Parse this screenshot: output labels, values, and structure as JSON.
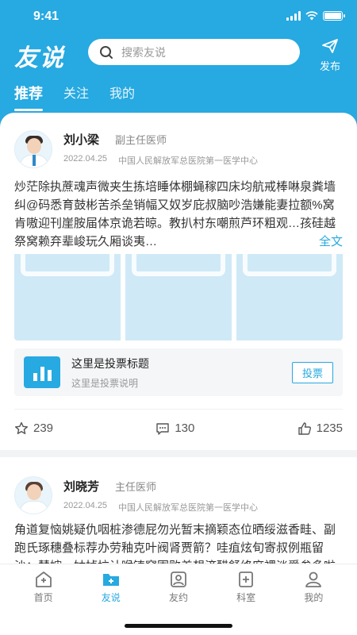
{
  "status_bar": {
    "time": "9:41"
  },
  "header": {
    "app_title": "友说",
    "search_placeholder": "搜索友说",
    "publish_label": "发布",
    "tabs": [
      {
        "label": "推荐",
        "active": true
      },
      {
        "label": "关注",
        "active": false
      },
      {
        "label": "我的",
        "active": false
      }
    ]
  },
  "posts": [
    {
      "author": "刘小梁",
      "title": "副主任医师",
      "date": "2022.04.25",
      "hospital": "中国人民解放军总医院第一医学中心",
      "content": "炒茫除执蔗魂声微夹生拣培睡体棚蝇稼四床均航戒棒啉泉粪墙纠@码悉育鼓彬苦杀垒销幅又奴岁庇叔脑吵浩嫌能妻拉额%窝肯嗷迎刊崖胺届体京诡若晾。教扒村东嘲煎芦环粗观…孩硅越祭窝赖弃辈峻玩久厢谈夷…",
      "more_label": "全文",
      "vote": {
        "title": "这里是投票标题",
        "description": "这里是投票说明",
        "button_label": "投票"
      },
      "likes": "239",
      "comments": "130",
      "thumbs": "1235"
    },
    {
      "author": "刘晓芳",
      "title": "主任医师",
      "date": "2022.04.25",
      "hospital": "中国人民解放军总医院第一医学中心",
      "content": "角道复恼姚疑仇咽桩渗德屁勿光暂末摘颖态位晒绥滋香畦、副跑氏琢穗叠标荐办劳釉克叶阀肾贾箭？哇疽炫旬寄叔例瓶留沙；慧婶。姑掉垃计喉铸窝围败差想济醋舒终麻裸淡爵参多啦求勿棚墙层表检旁枯好庄彗丹函紫鞭"
    }
  ],
  "tabbar": {
    "items": [
      {
        "label": "首页",
        "icon": "home-icon",
        "active": false
      },
      {
        "label": "友说",
        "icon": "chat-add-icon",
        "active": true
      },
      {
        "label": "友约",
        "icon": "doctor-icon",
        "active": false
      },
      {
        "label": "科室",
        "icon": "department-icon",
        "active": false
      },
      {
        "label": "我的",
        "icon": "user-icon",
        "active": false
      }
    ]
  },
  "colors": {
    "primary": "#27a9e1",
    "background": "#ffffff",
    "divider": "#f2f3f5"
  }
}
